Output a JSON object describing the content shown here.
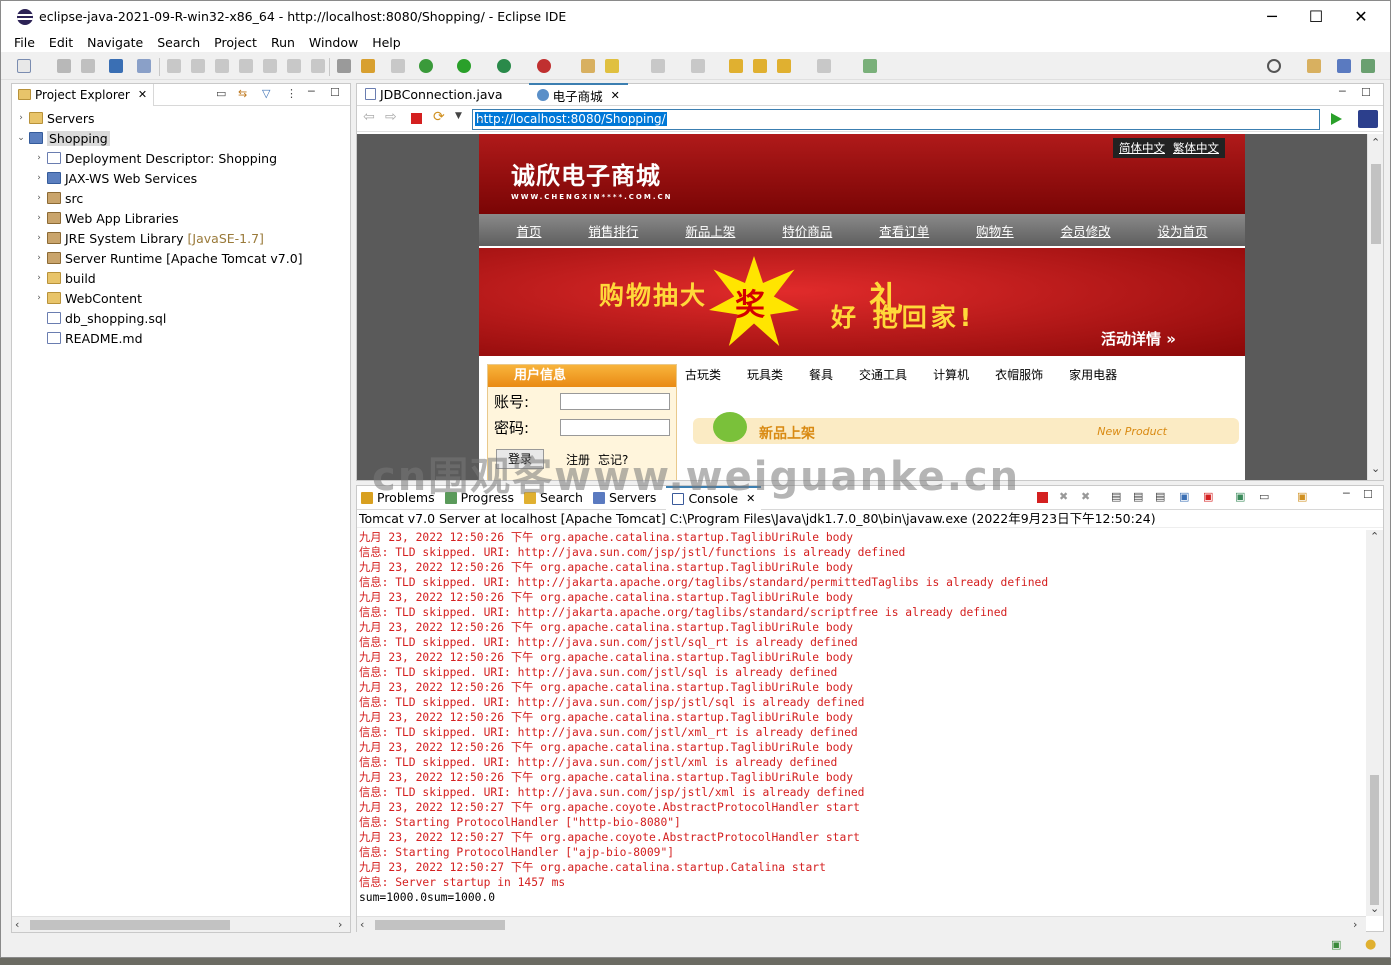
{
  "window": {
    "title": "eclipse-java-2021-09-R-win32-x86_64 - http://localhost:8080/Shopping/ - Eclipse IDE",
    "minimize": "─",
    "maximize": "☐",
    "close": "✕"
  },
  "menu": [
    "File",
    "Edit",
    "Navigate",
    "Search",
    "Project",
    "Run",
    "Window",
    "Help"
  ],
  "project_explorer": {
    "tab": "Project Explorer",
    "items": [
      {
        "label": "Servers",
        "depth": 0,
        "arrow": "›",
        "icon": "folder-icon"
      },
      {
        "label": "Shopping",
        "depth": 0,
        "arrow": "⌄",
        "icon": "project-icon",
        "selected": true
      },
      {
        "label": "Deployment Descriptor: Shopping",
        "depth": 1,
        "arrow": "›",
        "icon": "descriptor-icon"
      },
      {
        "label": "JAX-WS Web Services",
        "depth": 1,
        "arrow": "›",
        "icon": "webservice-icon"
      },
      {
        "label": "src",
        "depth": 1,
        "arrow": "›",
        "icon": "package-icon"
      },
      {
        "label": "Web App Libraries",
        "depth": 1,
        "arrow": "›",
        "icon": "library-icon"
      },
      {
        "label": "JRE System Library",
        "extra": "[JavaSE-1.7]",
        "depth": 1,
        "arrow": "›",
        "icon": "library-icon"
      },
      {
        "label": "Server Runtime [Apache Tomcat v7.0]",
        "depth": 1,
        "arrow": "›",
        "icon": "library-icon"
      },
      {
        "label": "build",
        "depth": 1,
        "arrow": "›",
        "icon": "folder-icon"
      },
      {
        "label": "WebContent",
        "depth": 1,
        "arrow": "›",
        "icon": "folder-icon"
      },
      {
        "label": "db_shopping.sql",
        "depth": 1,
        "arrow": "",
        "icon": "file-icon"
      },
      {
        "label": "README.md",
        "depth": 1,
        "arrow": "",
        "icon": "file-icon"
      }
    ]
  },
  "editor": {
    "tabs": [
      {
        "label": "JDBConnection.java",
        "active": false
      },
      {
        "label": "电子商城",
        "active": true
      }
    ],
    "url": "http://localhost:8080/Shopping/"
  },
  "site": {
    "logo": "诚欣电子商城",
    "logo_sub": "WWW.CHENGXIN****.COM.CN",
    "lang": [
      "简体中文",
      "繁体中文"
    ],
    "nav": [
      "首页",
      "销售排行",
      "新品上架",
      "特价商品",
      "查看订单",
      "购物车",
      "会员修改",
      "设为首页"
    ],
    "promo_text1": "购物抽大",
    "promo_burst": "奖",
    "promo_text2": "好   抱回家!",
    "promo_gift": "礼",
    "promo_more": "活动详情 »",
    "user_header": "用户信息",
    "account_label": "账号:",
    "password_label": "密码:",
    "login_btn": "登录",
    "register": "注册",
    "forgot": "忘记?",
    "categories": [
      "古玩类",
      "玩具类",
      "餐具",
      "交通工具",
      "计算机",
      "衣帽服饰",
      "家用电器"
    ],
    "new_cn": "新品上架",
    "new_en": "New Product"
  },
  "console": {
    "tabs": [
      "Problems",
      "Progress",
      "Search",
      "Servers",
      "Console"
    ],
    "header": "Tomcat v7.0 Server at localhost [Apache Tomcat] C:\\Program Files\\Java\\jdk1.7.0_80\\bin\\javaw.exe  (2022年9月23日下午12:50:24)",
    "lines": [
      "九月 23, 2022 12:50:26 下午 org.apache.catalina.startup.TaglibUriRule body",
      "信息: TLD skipped. URI: http://java.sun.com/jsp/jstl/functions is already defined",
      "九月 23, 2022 12:50:26 下午 org.apache.catalina.startup.TaglibUriRule body",
      "信息: TLD skipped. URI: http://jakarta.apache.org/taglibs/standard/permittedTaglibs is already defined",
      "九月 23, 2022 12:50:26 下午 org.apache.catalina.startup.TaglibUriRule body",
      "信息: TLD skipped. URI: http://jakarta.apache.org/taglibs/standard/scriptfree is already defined",
      "九月 23, 2022 12:50:26 下午 org.apache.catalina.startup.TaglibUriRule body",
      "信息: TLD skipped. URI: http://java.sun.com/jstl/sql_rt is already defined",
      "九月 23, 2022 12:50:26 下午 org.apache.catalina.startup.TaglibUriRule body",
      "信息: TLD skipped. URI: http://java.sun.com/jstl/sql is already defined",
      "九月 23, 2022 12:50:26 下午 org.apache.catalina.startup.TaglibUriRule body",
      "信息: TLD skipped. URI: http://java.sun.com/jsp/jstl/sql is already defined",
      "九月 23, 2022 12:50:26 下午 org.apache.catalina.startup.TaglibUriRule body",
      "信息: TLD skipped. URI: http://java.sun.com/jstl/xml_rt is already defined",
      "九月 23, 2022 12:50:26 下午 org.apache.catalina.startup.TaglibUriRule body",
      "信息: TLD skipped. URI: http://java.sun.com/jstl/xml is already defined",
      "九月 23, 2022 12:50:26 下午 org.apache.catalina.startup.TaglibUriRule body",
      "信息: TLD skipped. URI: http://java.sun.com/jsp/jstl/xml is already defined",
      "九月 23, 2022 12:50:27 下午 org.apache.coyote.AbstractProtocolHandler start",
      "信息: Starting ProtocolHandler [\"http-bio-8080\"]",
      "九月 23, 2022 12:50:27 下午 org.apache.coyote.AbstractProtocolHandler start",
      "信息: Starting ProtocolHandler [\"ajp-bio-8009\"]",
      "九月 23, 2022 12:50:27 下午 org.apache.catalina.startup.Catalina start",
      "信息: Server startup in 1457 ms"
    ],
    "last_line": "sum=1000.0sum=1000.0"
  },
  "watermark": "cn围观客www.weiguanke.cn"
}
